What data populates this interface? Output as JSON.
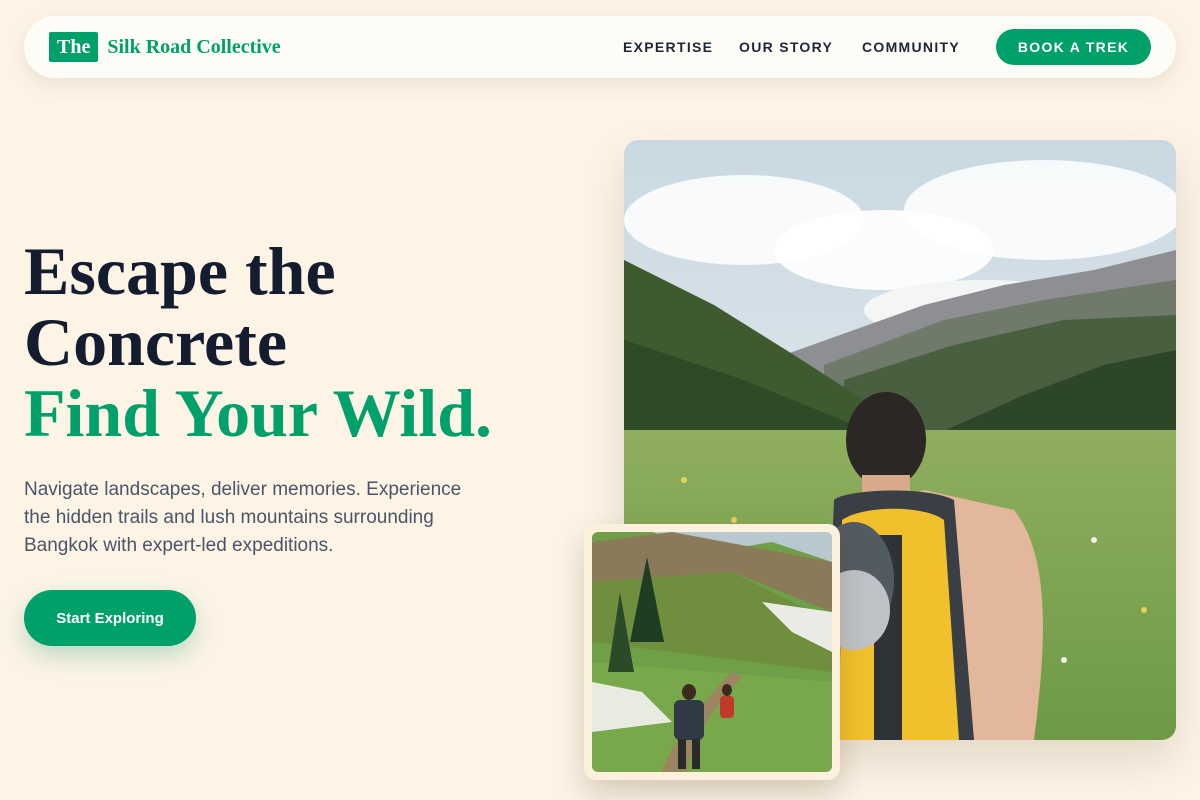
{
  "brand": {
    "badge": "The",
    "name": "Silk Road Collective"
  },
  "nav": {
    "links": [
      {
        "label": "EXPERTISE"
      },
      {
        "label": "OUR STORY"
      },
      {
        "label": "COMMUNITY"
      }
    ],
    "cta_label": "BOOK A TREK"
  },
  "hero": {
    "line1": "Escape the",
    "line2": "Concrete",
    "line3": "Find Your Wild.",
    "description": "Navigate landscapes, deliver memories. Experience the hidden trails and lush mountains surrounding Bangkok with expert-led expeditions.",
    "cta_label": "Start Exploring"
  },
  "colors": {
    "accent": "#00a06a",
    "background": "#fdf4e6"
  }
}
